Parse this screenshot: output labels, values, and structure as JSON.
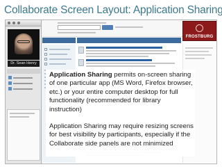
{
  "slide": {
    "title": "Collaborate Screen Layout: Application Sharing"
  },
  "collaborate": {
    "presenter_name": "Dr. Sean Henry"
  },
  "library_page": {
    "logo_text": "FROSTBURG"
  },
  "callout": {
    "p1_term": "Application Sharing",
    "p1_rest": " permits on-screen sharing of one particular app (MS Word, Firefox browser, etc.) or your entire computer desktop for full functionality (recommended for library instruction)",
    "p2": "Application Sharing may require resizing screens for best visibility by participants, especially if the Collaborate side panels are not minimized"
  },
  "colors": {
    "title": "#3d7990",
    "bar_blue": "#3d6b9e",
    "logo_red": "#8d1a1a"
  }
}
